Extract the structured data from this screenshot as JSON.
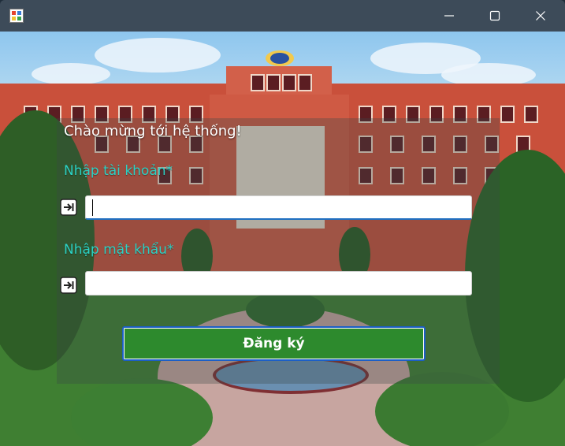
{
  "window": {
    "title": "",
    "controls": {
      "minimize_icon": "minimize-icon",
      "maximize_icon": "maximize-icon",
      "close_icon": "close-icon"
    }
  },
  "form": {
    "greeting": "Chào mừng tới hệ thống!",
    "username_label": "Nhập tài khoản*",
    "username_value": "",
    "password_label": "Nhập mật khẩu*",
    "password_value": "",
    "submit_label": "Đăng ký"
  },
  "colors": {
    "titlebar": "#3d4b59",
    "label_accent": "#2bd1c4",
    "button_green": "#2d8a2d",
    "button_border": "#1c5fc6"
  }
}
